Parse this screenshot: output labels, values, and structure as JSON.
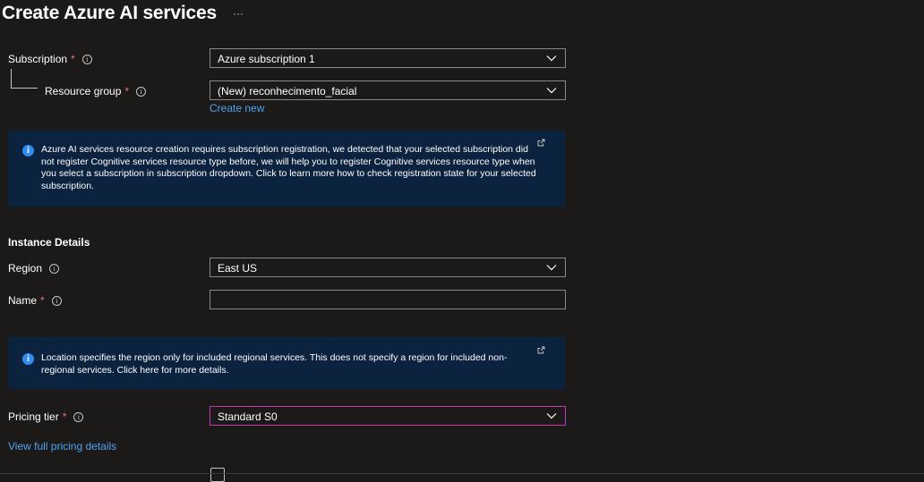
{
  "page": {
    "title": "Create Azure AI services",
    "more_label": "···"
  },
  "project": {
    "subscription": {
      "label": "Subscription",
      "required": "*",
      "value": "Azure subscription 1"
    },
    "resource_group": {
      "label": "Resource group",
      "required": "*",
      "value": "(New) reconhecimento_facial",
      "create_new": "Create new"
    }
  },
  "info_icon_glyph": "i",
  "banner_subscription": {
    "text": "Azure AI services resource creation requires subscription registration, we detected that your selected subscription did not register Cognitive services resource type before, we will help you to register Cognitive services resource type when you select a subscription in subscription dropdown. Click to learn more how to check registration state for your selected subscription."
  },
  "instance_details": {
    "title": "Instance Details",
    "region": {
      "label": "Region",
      "value": "East US"
    },
    "name": {
      "label": "Name",
      "required": "*",
      "value": ""
    }
  },
  "banner_location": {
    "text": "Location specifies the region only for included regional services. This does not specify a region for included non-regional services. Click here for more details."
  },
  "pricing": {
    "label": "Pricing tier",
    "required": "*",
    "value": "Standard S0",
    "details_link": "View full pricing details"
  },
  "colors": {
    "background": "#1b1a19",
    "banner": "#0c2340",
    "link": "#4ea3f0",
    "required": "#f1707b",
    "focus_border": "#c239b3",
    "info_icon": "#2f8cf0"
  }
}
